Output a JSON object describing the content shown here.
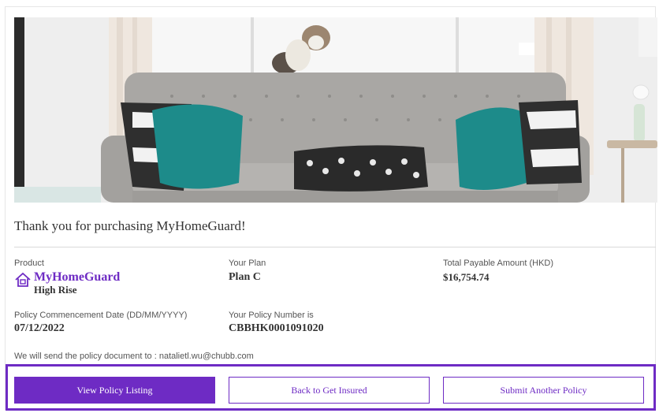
{
  "confirmation": {
    "title": "Thank you for purchasing MyHomeGuard!"
  },
  "product": {
    "label": "Product",
    "name": "MyHomeGuard",
    "subtitle": "High Rise",
    "icon": "house-icon"
  },
  "plan": {
    "label": "Your Plan",
    "value": "Plan C"
  },
  "amount": {
    "label": "Total Payable Amount (HKD)",
    "value": "$16,754.74"
  },
  "commencement": {
    "label": "Policy Commencement Date (DD/MM/YYYY)",
    "value": "07/12/2022"
  },
  "policy_number": {
    "label": "Your Policy Number is",
    "value": "CBBHK0001091020"
  },
  "notice": "We will send the policy document to : natalietl.wu@chubb.com",
  "buttons": {
    "view_policy": "View Policy Listing",
    "back": "Back to Get Insured",
    "submit_another": "Submit Another Policy"
  },
  "colors": {
    "accent": "#6e2bc4",
    "text": "#333333"
  }
}
